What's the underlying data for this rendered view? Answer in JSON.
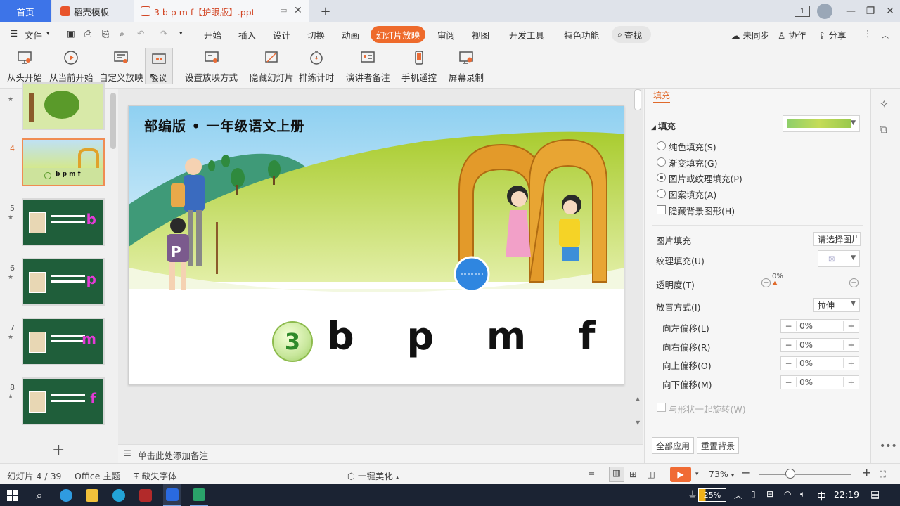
{
  "tabs": {
    "home": "首页",
    "template": "稻壳模板",
    "document": "3 b p m f【护眼版】.ppt"
  },
  "menu": {
    "file": "文件",
    "items": [
      "开始",
      "插入",
      "设计",
      "切换",
      "动画",
      "幻灯片放映",
      "审阅",
      "视图",
      "开发工具",
      "特色功能"
    ],
    "active": "幻灯片放映",
    "search": "查找",
    "sync": "未同步",
    "collab": "协作",
    "share": "分享"
  },
  "ribbon": {
    "buttons": [
      {
        "label": "从头开始",
        "icon": "projector-start-icon"
      },
      {
        "label": "从当前开始",
        "icon": "play-circle-icon"
      },
      {
        "label": "自定义放映",
        "icon": "custom-show-icon"
      },
      {
        "label": "会议",
        "icon": "meeting-icon"
      },
      {
        "label": "设置放映方式",
        "icon": "show-settings-icon"
      },
      {
        "label": "隐藏幻灯片",
        "icon": "hide-slide-icon"
      },
      {
        "label": "排练计时",
        "icon": "timer-icon"
      },
      {
        "label": "演讲者备注",
        "icon": "speaker-notes-icon"
      },
      {
        "label": "手机遥控",
        "icon": "phone-remote-icon"
      },
      {
        "label": "屏幕录制",
        "icon": "screen-record-icon"
      }
    ]
  },
  "thumbnails": [
    {
      "num": "4",
      "letter": "",
      "active": true
    },
    {
      "num": "5",
      "letter": "b",
      "active": false
    },
    {
      "num": "6",
      "letter": "p",
      "active": false
    },
    {
      "num": "7",
      "letter": "m",
      "active": false
    },
    {
      "num": "8",
      "letter": "f",
      "active": false
    }
  ],
  "slide": {
    "title": "部编版 • 一年级语文上册",
    "lesson_number": "3",
    "letters": "b p m f"
  },
  "notes_placeholder": "单击此处添加备注",
  "panel": {
    "section": "填充",
    "options": [
      {
        "label": "纯色填充(S)",
        "type": "radio",
        "checked": false
      },
      {
        "label": "渐变填充(G)",
        "type": "radio",
        "checked": false
      },
      {
        "label": "图片或纹理填充(P)",
        "type": "radio",
        "checked": true
      },
      {
        "label": "图案填充(A)",
        "type": "radio",
        "checked": false
      },
      {
        "label": "隐藏背景图形(H)",
        "type": "checkbox",
        "checked": false
      }
    ],
    "picture_fill_label": "图片填充",
    "picture_fill_value": "请选择图片",
    "texture_fill_label": "纹理填充(U)",
    "transparency_label": "透明度(T)",
    "transparency_value": "0%",
    "placement_label": "放置方式(I)",
    "placement_value": "拉伸",
    "offsets": [
      {
        "label": "向左偏移(L)",
        "value": "0%"
      },
      {
        "label": "向右偏移(R)",
        "value": "0%"
      },
      {
        "label": "向上偏移(O)",
        "value": "0%"
      },
      {
        "label": "向下偏移(M)",
        "value": "0%"
      }
    ],
    "rotate_with_shape": "与形状一起旋转(W)",
    "apply_all": "全部应用",
    "reset_bg": "重置背景"
  },
  "status": {
    "slide_counter": "幻灯片 4 / 39",
    "theme": "Office 主题",
    "missing_font": "缺失字体",
    "beautify": "一键美化",
    "zoom": "73%"
  },
  "taskbar": {
    "battery": "25%",
    "ime": "中",
    "time": "22:19"
  }
}
